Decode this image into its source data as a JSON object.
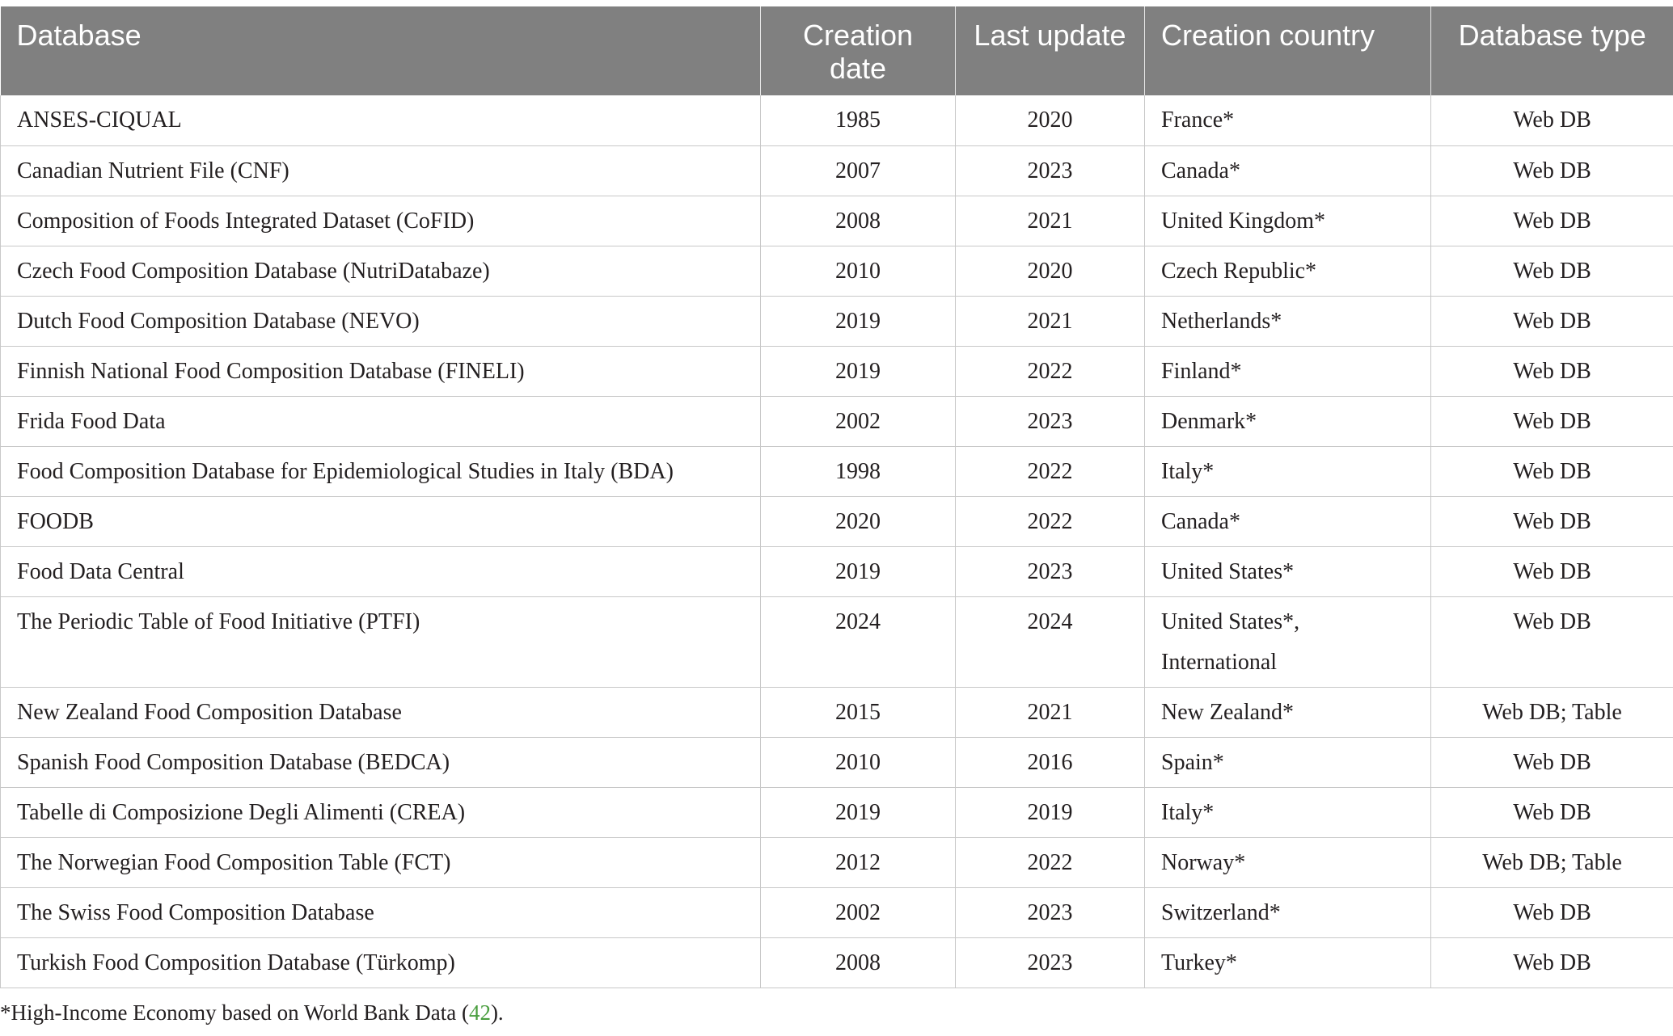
{
  "table": {
    "headers": [
      {
        "label": "Database",
        "align": "left"
      },
      {
        "label": "Creation date",
        "align": "center"
      },
      {
        "label": "Last update",
        "align": "center"
      },
      {
        "label": "Creation country",
        "align": "left"
      },
      {
        "label": "Database type",
        "align": "center"
      }
    ],
    "rows": [
      {
        "database": "ANSES-CIQUAL",
        "creation_date": "1985",
        "last_update": "2020",
        "country": "France*",
        "type": "Web DB"
      },
      {
        "database": "Canadian Nutrient File (CNF)",
        "creation_date": "2007",
        "last_update": "2023",
        "country": "Canada*",
        "type": "Web DB"
      },
      {
        "database": "Composition of Foods Integrated Dataset (CoFID)",
        "creation_date": "2008",
        "last_update": "2021",
        "country": "United Kingdom*",
        "type": "Web DB"
      },
      {
        "database": "Czech Food Composition Database (NutriDatabaze)",
        "creation_date": "2010",
        "last_update": "2020",
        "country": "Czech Republic*",
        "type": "Web DB"
      },
      {
        "database": "Dutch Food Composition Database (NEVO)",
        "creation_date": "2019",
        "last_update": "2021",
        "country": "Netherlands*",
        "type": "Web DB"
      },
      {
        "database": "Finnish National Food Composition Database (FINELI)",
        "creation_date": "2019",
        "last_update": "2022",
        "country": "Finland*",
        "type": "Web DB"
      },
      {
        "database": "Frida Food Data",
        "creation_date": "2002",
        "last_update": "2023",
        "country": "Denmark*",
        "type": "Web DB"
      },
      {
        "database": "Food Composition Database for Epidemiological Studies in Italy (BDA)",
        "creation_date": "1998",
        "last_update": "2022",
        "country": "Italy*",
        "type": "Web DB"
      },
      {
        "database": "FOODB",
        "creation_date": "2020",
        "last_update": "2022",
        "country": "Canada*",
        "type": "Web DB"
      },
      {
        "database": "Food Data Central",
        "creation_date": "2019",
        "last_update": "2023",
        "country": "United States*",
        "type": "Web DB"
      },
      {
        "database": "The Periodic Table of Food Initiative (PTFI)",
        "creation_date": "2024",
        "last_update": "2024",
        "country": "United States*,",
        "country_line2": "International",
        "type": "Web DB"
      },
      {
        "database": "New Zealand Food Composition Database",
        "creation_date": "2015",
        "last_update": "2021",
        "country": "New Zealand*",
        "type": "Web DB; Table"
      },
      {
        "database": "Spanish Food Composition Database (BEDCA)",
        "creation_date": "2010",
        "last_update": "2016",
        "country": "Spain*",
        "type": "Web DB"
      },
      {
        "database": "Tabelle di Composizione Degli Alimenti (CREA)",
        "creation_date": "2019",
        "last_update": "2019",
        "country": "Italy*",
        "type": "Web DB"
      },
      {
        "database": "The Norwegian Food Composition Table (FCT)",
        "creation_date": "2012",
        "last_update": "2022",
        "country": "Norway*",
        "type": "Web DB; Table"
      },
      {
        "database": "The Swiss Food Composition Database",
        "creation_date": "2002",
        "last_update": "2023",
        "country": "Switzerland*",
        "type": "Web DB"
      },
      {
        "database": "Turkish Food Composition Database (Türkomp)",
        "creation_date": "2008",
        "last_update": "2023",
        "country": "Turkey*",
        "type": "Web DB"
      }
    ]
  },
  "footnote": {
    "text_before": "*High-Income Economy based on World Bank Data (",
    "ref": "42",
    "text_after": ")."
  },
  "colors": {
    "header_bg": "#808080",
    "header_text": "#ffffff",
    "grid": "#c8c8c8",
    "ref_link": "#4a9e3f"
  }
}
